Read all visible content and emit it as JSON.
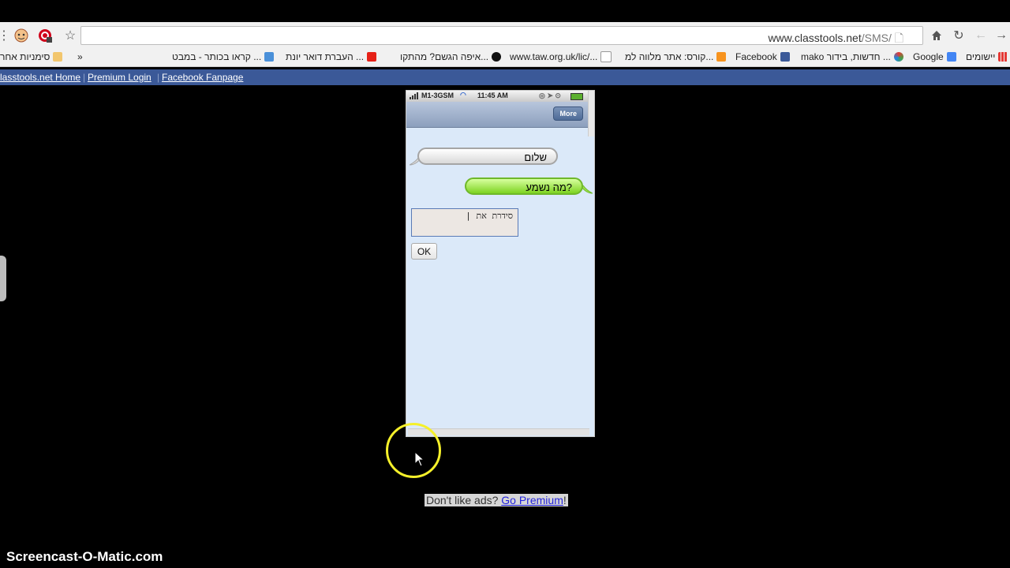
{
  "browser": {
    "url_domain": "www.classtools.net",
    "url_path": "/SMS/",
    "bookmarks": [
      {
        "label": "סימניות אחר",
        "icon": "folder-icon"
      },
      {
        "label": "»",
        "icon": ""
      },
      {
        "label": "קראו בכותר - במבט ...",
        "icon": "site-icon"
      },
      {
        "label": "העברת דואר יונת ...",
        "icon": "youtube-icon"
      },
      {
        "label": "איפה הגשם? מהתקו...",
        "icon": "info-icon"
      },
      {
        "label": "www.taw.org.uk/lic/...",
        "icon": "page-icon"
      },
      {
        "label": "קורס: אתר מלווה למ...",
        "icon": "moodle-icon"
      },
      {
        "label": "Facebook",
        "icon": "facebook-icon"
      },
      {
        "label": "mako חדשות, בידור ...",
        "icon": "mako-icon"
      },
      {
        "label": "Google",
        "icon": "google-icon"
      },
      {
        "label": "יישומים",
        "icon": "apps-icon"
      }
    ]
  },
  "site_nav": {
    "links": [
      "classtools.net Home",
      "Premium Login",
      "Facebook Fanpage"
    ]
  },
  "phone": {
    "carrier": "M1-3GSM",
    "time": "11:45 AM",
    "more_button": "More",
    "messages": {
      "incoming": "שלום",
      "outgoing": "?מה נשמע"
    },
    "input_value": "סידרת את",
    "ok_button": "OK"
  },
  "ad": {
    "text": "Don't like ads?",
    "link": "Go Premium",
    "suffix": "!"
  },
  "watermark": "Screencast-O-Matic.com",
  "colors": {
    "site_nav_bg": "#3b5998",
    "incoming_bubble": "#e6e6e6",
    "outgoing_bubble": "#9be04a",
    "cursor_ring": "#f5f02a"
  }
}
